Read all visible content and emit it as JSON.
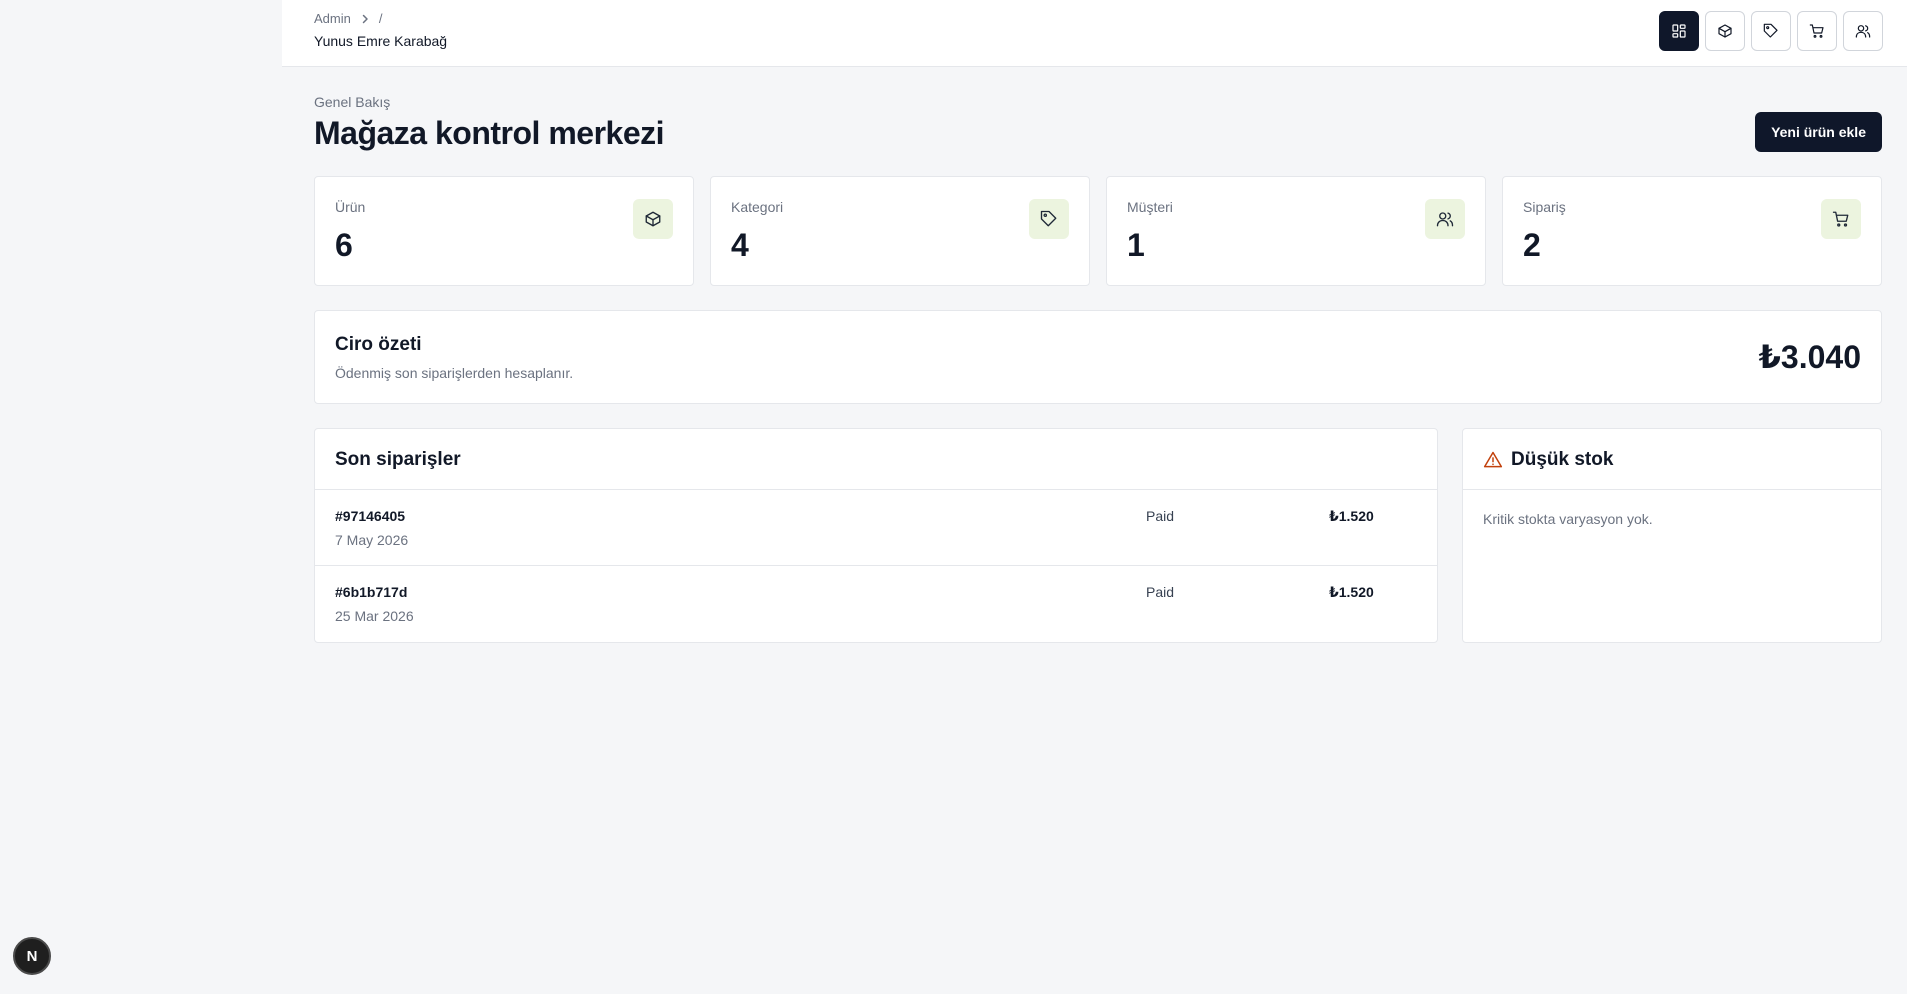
{
  "breadcrumb": {
    "root": "Admin",
    "separator": "/",
    "user": "Yunus Emre Karabağ"
  },
  "nav": {
    "items": [
      {
        "icon": "dashboard-icon",
        "active": true
      },
      {
        "icon": "box-icon",
        "active": false
      },
      {
        "icon": "tag-icon",
        "active": false
      },
      {
        "icon": "cart-icon",
        "active": false
      },
      {
        "icon": "users-icon",
        "active": false
      }
    ]
  },
  "header": {
    "eyebrow": "Genel Bakış",
    "title": "Mağaza kontrol merkezi",
    "new_product_label": "Yeni ürün ekle"
  },
  "stats": [
    {
      "label": "Ürün",
      "value": "6",
      "icon": "box-icon"
    },
    {
      "label": "Kategori",
      "value": "4",
      "icon": "tag-icon"
    },
    {
      "label": "Müşteri",
      "value": "1",
      "icon": "users-icon"
    },
    {
      "label": "Sipariş",
      "value": "2",
      "icon": "cart-icon"
    }
  ],
  "revenue": {
    "title": "Ciro özeti",
    "subtitle": "Ödenmiş son siparişlerden hesaplanır.",
    "total": "₺3.040"
  },
  "orders": {
    "title": "Son siparişler",
    "rows": [
      {
        "id": "#97146405",
        "date": "7 May 2026",
        "status": "Paid",
        "total": "₺1.520"
      },
      {
        "id": "#6b1b717d",
        "date": "25 Mar 2026",
        "status": "Paid",
        "total": "₺1.520"
      }
    ]
  },
  "low_stock": {
    "title": "Düşük stok",
    "empty_message": "Kritik stokta varyasyon yok.",
    "icon": "warning-icon"
  },
  "fab": {
    "label": "N"
  },
  "colors": {
    "primary": "#0f172a",
    "icon_bg": "#ecf4df",
    "warning": "#c2410c",
    "background": "#f5f6f8"
  }
}
